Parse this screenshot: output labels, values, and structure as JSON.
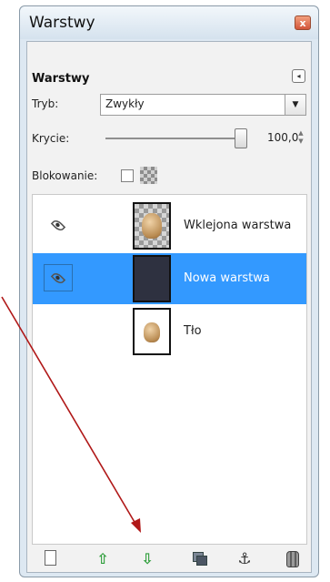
{
  "window": {
    "title": "Warstwy",
    "close_glyph": "x",
    "close_color": "#d3553a"
  },
  "panel": {
    "header": "Warstwy",
    "menu_glyph": "◂",
    "mode_label": "Tryb:",
    "mode_value": "Zwykły",
    "opacity_label": "Krycie:",
    "opacity_value": "100,0",
    "opacity_level_percent": 100,
    "lock_label": "Blokowanie:"
  },
  "layers": [
    {
      "name": "Wklejona warstwa",
      "visible": true,
      "selected": false,
      "thumbnail": "checker"
    },
    {
      "name": "Nowa warstwa",
      "visible": true,
      "selected": true,
      "thumbnail": "dark"
    },
    {
      "name": "Tło",
      "visible": false,
      "selected": false,
      "thumbnail": "white"
    }
  ],
  "toolbar": {
    "icons": [
      "new-layer-icon",
      "raise-layer-icon",
      "lower-layer-icon",
      "duplicate-layer-icon",
      "anchor-icon",
      "delete-layer-icon"
    ],
    "raise_glyph": "⇧",
    "lower_glyph": "⇩",
    "anchor_glyph": "⚓"
  },
  "colors": {
    "selection": "#3399ff",
    "annotation_arrow": "#b01818",
    "arrow_icon": "#2e9e3b"
  }
}
